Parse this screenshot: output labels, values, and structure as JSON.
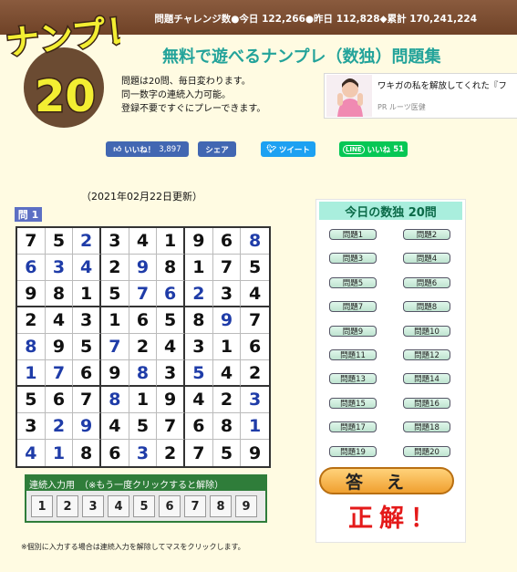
{
  "header": {
    "stats": "問題チャレンジ数●今日 122,266●昨日 112,828◆累計 170,241,224"
  },
  "logo": {
    "text_top": "ナンプレ",
    "text_bottom": "20"
  },
  "site_title": "無料で遊べるナンプレ（数独）問題集",
  "description": [
    "問題は20問、毎日変わります。",
    "同一数字の連続入力可能。",
    "登録不要ですぐにプレーできます。"
  ],
  "ad": {
    "headline": "ワキガの私を解放してくれた『フ",
    "source": "PR ルーツ医健"
  },
  "social": {
    "like_label": "いいね！",
    "like_count": "3,897",
    "share_label": "シェア",
    "tweet_label": "ツイート",
    "line_label": "いいね",
    "line_count": "51"
  },
  "updated": "（2021年02月22日更新）",
  "question_label": "問 1",
  "board": [
    [
      "7",
      "5",
      "2",
      "3",
      "4",
      "1",
      "9",
      "6",
      "8"
    ],
    [
      "6",
      "3",
      "4",
      "2",
      "9",
      "8",
      "1",
      "7",
      "5"
    ],
    [
      "9",
      "8",
      "1",
      "5",
      "7",
      "6",
      "2",
      "3",
      "4"
    ],
    [
      "2",
      "4",
      "3",
      "1",
      "6",
      "5",
      "8",
      "9",
      "7"
    ],
    [
      "8",
      "9",
      "5",
      "7",
      "2",
      "4",
      "3",
      "1",
      "6"
    ],
    [
      "1",
      "7",
      "6",
      "9",
      "8",
      "3",
      "5",
      "4",
      "2"
    ],
    [
      "5",
      "6",
      "7",
      "8",
      "1",
      "9",
      "4",
      "2",
      "3"
    ],
    [
      "3",
      "2",
      "9",
      "4",
      "5",
      "7",
      "6",
      "8",
      "1"
    ],
    [
      "4",
      "1",
      "8",
      "6",
      "3",
      "2",
      "7",
      "5",
      "9"
    ]
  ],
  "input_cells": [
    [
      0,
      2
    ],
    [
      0,
      8
    ],
    [
      1,
      0
    ],
    [
      1,
      1
    ],
    [
      1,
      2
    ],
    [
      1,
      4
    ],
    [
      2,
      4
    ],
    [
      2,
      5
    ],
    [
      2,
      6
    ],
    [
      3,
      7
    ],
    [
      4,
      0
    ],
    [
      4,
      3
    ],
    [
      5,
      0
    ],
    [
      5,
      1
    ],
    [
      5,
      4
    ],
    [
      5,
      6
    ],
    [
      6,
      3
    ],
    [
      6,
      8
    ],
    [
      7,
      1
    ],
    [
      7,
      2
    ],
    [
      7,
      8
    ],
    [
      8,
      0
    ],
    [
      8,
      1
    ],
    [
      8,
      4
    ]
  ],
  "colors": {
    "given": "#111111",
    "input": "#1f3ca8",
    "correct": "#e41a1a",
    "title": "#23a39a"
  },
  "continuous": {
    "header": "連続入力用　（※もう一度クリックすると解除）",
    "keys": [
      "1",
      "2",
      "3",
      "4",
      "5",
      "6",
      "7",
      "8",
      "9"
    ]
  },
  "note": "※個別に入力する場合は連続入力を解除してマスをクリックします。",
  "panel": {
    "title": "今日の数独 20問",
    "buttons": [
      "問題1",
      "問題2",
      "問題3",
      "問題4",
      "問題5",
      "問題6",
      "問題7",
      "問題8",
      "問題9",
      "問題10",
      "問題11",
      "問題12",
      "問題13",
      "問題14",
      "問題15",
      "問題16",
      "問題17",
      "問題18",
      "問題19",
      "問題20"
    ]
  },
  "answer_label": "答え",
  "result": "正解！"
}
